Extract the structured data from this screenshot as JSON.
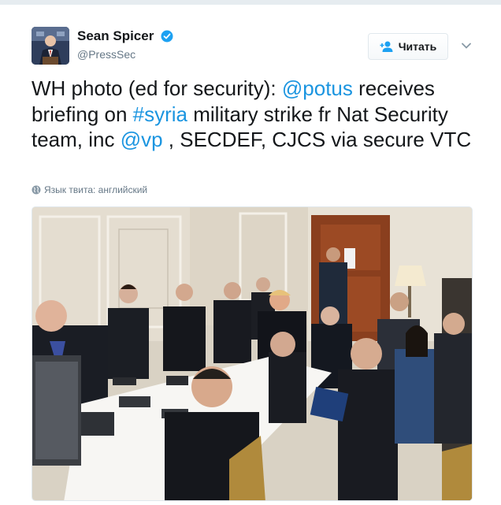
{
  "profile": {
    "display_name": "Sean Spicer",
    "handle": "@PressSec",
    "verified": true,
    "avatar_icon": "user-avatar-photo"
  },
  "follow_button": {
    "label": "Читать",
    "icon": "add-person-icon"
  },
  "menu": {
    "icon": "chevron-down-icon"
  },
  "tweet": {
    "segments": [
      {
        "text": "WH photo (ed for security): ",
        "type": "text"
      },
      {
        "text": "@potus",
        "type": "mention"
      },
      {
        "text": " receives briefing on ",
        "type": "text"
      },
      {
        "text": "#syria",
        "type": "hashtag"
      },
      {
        "text": " military strike fr Nat Security team, inc ",
        "type": "text"
      },
      {
        "text": "@vp",
        "type": "mention"
      },
      {
        "text": " , SECDEF, CJCS via secure VTC",
        "type": "text"
      }
    ],
    "language_label": "Язык твита: английский",
    "language_icon": "globe-icon"
  },
  "colors": {
    "link": "#1b95e0",
    "text": "#14171a",
    "meta": "#657786",
    "verified": "#1da1f2",
    "border": "#e1e8ed"
  }
}
